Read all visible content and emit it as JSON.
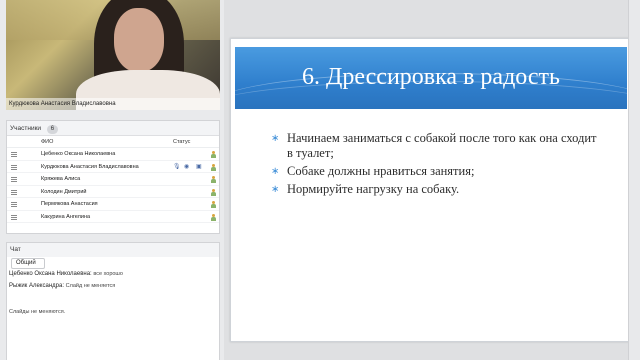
{
  "video": {
    "caption": "Курдюкова Анастасия  Владиславовна"
  },
  "participants": {
    "title": "Участники",
    "count": "6",
    "col_name": "ФИО",
    "col_status": "Статус",
    "rows": [
      {
        "name": "Цебенко Оксана Николаевна",
        "mic": false
      },
      {
        "name": "Курдюкова Анастасия  Владиславовна",
        "mic": true
      },
      {
        "name": "Кряжева Алиса",
        "mic": false
      },
      {
        "name": "Колодин Дмитрий",
        "mic": false
      },
      {
        "name": "Пермякова  Анастасия",
        "mic": false
      },
      {
        "name": "Какурина Ангелина",
        "mic": false
      }
    ]
  },
  "chat": {
    "title": "Чат",
    "tab": "Общий",
    "messages": [
      {
        "who": "Цебенко Оксана Николаевна:",
        "text": "все хорошо"
      },
      {
        "who": "Рыжик Александра:",
        "text": "Слайд не меняется"
      },
      {
        "who": "",
        "text": "Слайды не меняются."
      }
    ]
  },
  "slide": {
    "title": "6. Дрессировка в радость",
    "bullet_mark": "∗",
    "bullets": [
      "Начинаем заниматься с собакой после того как она сходит в туалет;",
      "Собаке должны нравиться занятия;",
      "Нормируйте нагрузку на собаку."
    ]
  },
  "colors": {
    "accent": "#3f8fd8",
    "banner": "#2f7fcd",
    "background": "#d8d9db"
  }
}
